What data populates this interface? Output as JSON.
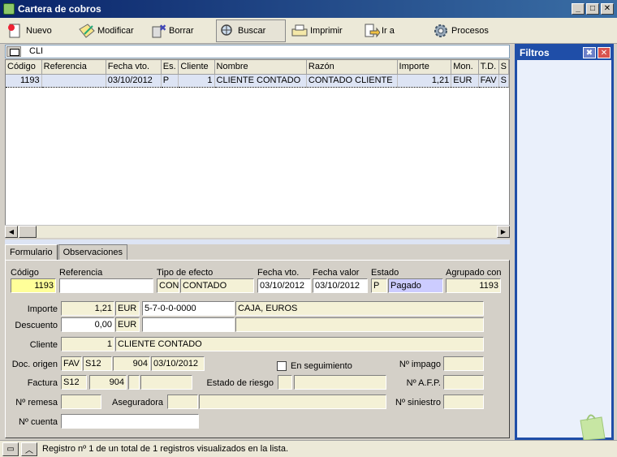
{
  "window": {
    "title": "Cartera de cobros",
    "minimize": "_",
    "maximize": "□",
    "close": "✕"
  },
  "toolbar": {
    "nuevo": "Nuevo",
    "modificar": "Modificar",
    "borrar": "Borrar",
    "buscar": "Buscar",
    "imprimir": "Imprimir",
    "ira": "Ir a",
    "procesos": "Procesos"
  },
  "search": {
    "value": "CLI"
  },
  "grid": {
    "columns": [
      "Código",
      "Referencia",
      "Fecha vto.",
      "Es.",
      "Cliente",
      "Nombre",
      "Razón",
      "Importe",
      "Mon.",
      "T.D.",
      "S"
    ],
    "rows": [
      [
        "1193",
        "",
        "03/10/2012",
        "P",
        "1",
        "CLIENTE CONTADO",
        "CONTADO CLIENTE",
        "1,21",
        "EUR",
        "FAV",
        "S"
      ]
    ]
  },
  "tabs": {
    "formulario": "Formulario",
    "observaciones": "Observaciones"
  },
  "form": {
    "codigo_label": "Código",
    "codigo": "1193",
    "referencia_label": "Referencia",
    "referencia": "",
    "tipo_label": "Tipo de efecto",
    "tipo_code": "CON",
    "tipo_name": "CONTADO",
    "fvto_label": "Fecha vto.",
    "fvto": "03/10/2012",
    "fvalor_label": "Fecha valor",
    "fvalor": "03/10/2012",
    "estado_label": "Estado",
    "estado_code": "P",
    "estado_name": "Pagado",
    "agrupado_label": "Agrupado con",
    "agrupado": "1193",
    "importe_label": "Importe",
    "importe": "1,21",
    "importe_mon": "EUR",
    "cuenta_code": "5-7-0-0-0000",
    "cuenta_name": "CAJA, EUROS",
    "descuento_label": "Descuento",
    "descuento": "0,00",
    "descuento_mon": "EUR",
    "cliente_label": "Cliente",
    "cliente_code": "1",
    "cliente_name": "CLIENTE CONTADO",
    "docorigen_label": "Doc. origen",
    "doc_tipo": "FAV",
    "doc_serie": "S12",
    "doc_num": "904",
    "doc_fecha": "03/10/2012",
    "seguimiento_label": "En seguimiento",
    "impago_label": "Nº impago",
    "factura_label": "Factura",
    "fact_serie": "S12",
    "fact_num": "904",
    "riesgo_label": "Estado de riesgo",
    "afp_label": "Nº A.F.P.",
    "remesa_label": "Nº remesa",
    "aseguradora_label": "Aseguradora",
    "siniestro_label": "Nº siniestro",
    "ncuenta_label": "Nº cuenta"
  },
  "filters": {
    "title": "Filtros"
  },
  "status": {
    "text": "Registro nº 1 de un total de 1 registros visualizados en la lista."
  },
  "colors": {
    "title": "#0a246a",
    "selection": "#dde4f4",
    "field": "#f4f1d6"
  }
}
